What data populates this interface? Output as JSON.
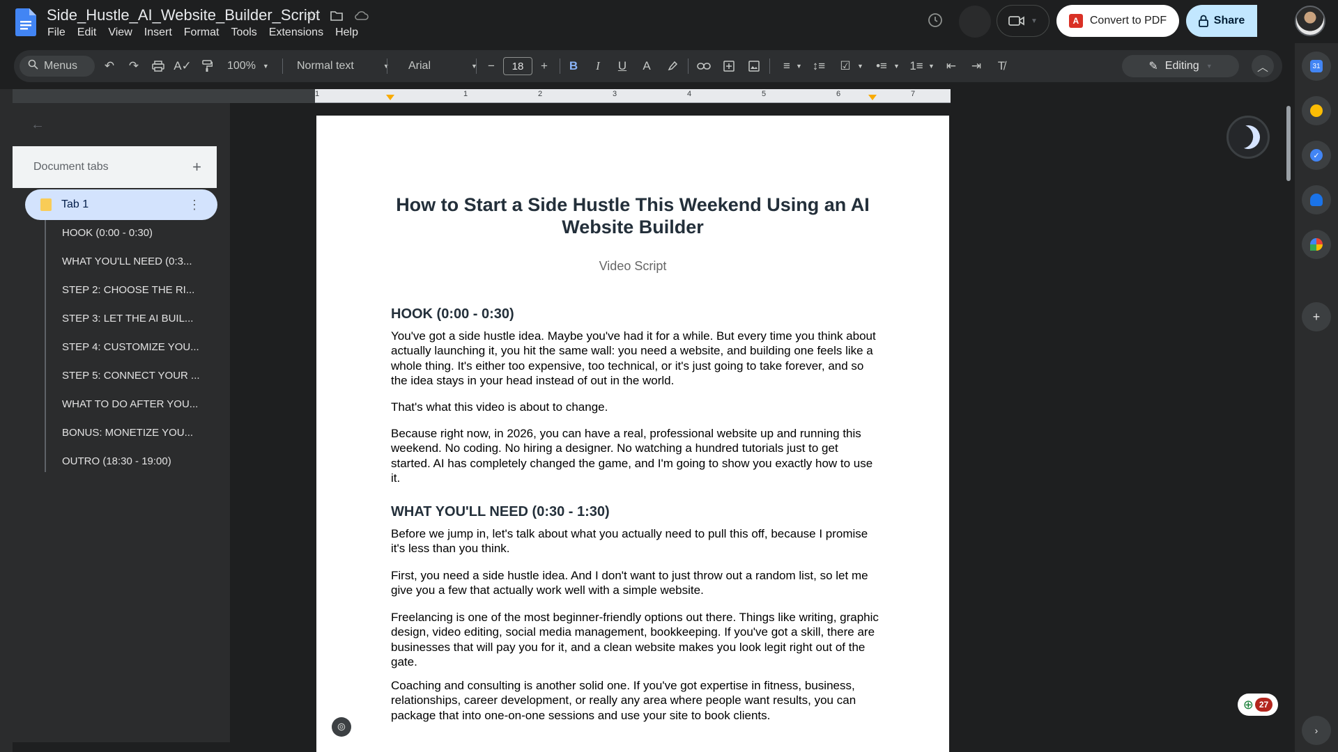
{
  "window": {
    "doc_title": "Side_Hustle_AI_Website_Builder_Script",
    "menu": [
      "File",
      "Edit",
      "View",
      "Insert",
      "Format",
      "Tools",
      "Extensions",
      "Help"
    ]
  },
  "header_actions": {
    "convert_pdf_label": "Convert to PDF",
    "share_label": "Share"
  },
  "toolbar": {
    "menus_label": "Menus",
    "zoom": "100%",
    "style": "Normal text",
    "font": "Arial",
    "font_size": "18",
    "bold_label": "B",
    "italic_label": "I",
    "underline_label": "U",
    "text_color_label": "A",
    "editing_label": "Editing"
  },
  "ruler": {
    "numbers": [
      "1",
      "1",
      "2",
      "3",
      "4",
      "5",
      "6",
      "7"
    ]
  },
  "sidebar": {
    "header": "Document tabs",
    "tab_name": "Tab 1",
    "outline": [
      "HOOK (0:00 - 0:30)",
      "WHAT YOU'LL NEED (0:3...",
      "STEP 2: CHOOSE THE RI...",
      "STEP 3: LET THE AI BUIL...",
      "STEP 4: CUSTOMIZE YOU...",
      "STEP 5: CONNECT YOUR ...",
      "WHAT TO DO AFTER YOU...",
      "BONUS: MONETIZE YOU...",
      "OUTRO (18:30 - 19:00)"
    ]
  },
  "document": {
    "title": "How to Start a Side Hustle This Weekend Using an AI Website Builder",
    "subtitle": "Video Script",
    "sections": [
      {
        "heading": "HOOK (0:00 - 0:30)",
        "paragraphs": [
          "You've got a side hustle idea. Maybe you've had it for a while. But every time you think about actually launching it, you hit the same wall: you need a website, and building one feels like a whole thing. It's either too expensive, too technical, or it's just going to take forever, and so the idea stays in your head instead of out in the world.",
          "That's what this video is about to change.",
          "Because right now, in 2026, you can have a real, professional website up and running this weekend. No coding. No hiring a designer. No watching a hundred tutorials just to get started. AI has completely changed the game, and I'm going to show you exactly how to use it."
        ]
      },
      {
        "heading": "WHAT YOU'LL NEED (0:30 - 1:30)",
        "paragraphs": [
          "Before we jump in, let's talk about what you actually need to pull this off, because I promise it's less than you think.",
          "First, you need a side hustle idea. And I don't want to just throw out a random list, so let me give you a few that actually work well with a simple website.",
          "Freelancing is one of the most beginner-friendly options out there. Things like writing, graphic design, video editing, social media management, bookkeeping. If you've got a skill, there are businesses that will pay you for it, and a clean website makes you look legit right out of the gate.",
          "Coaching and consulting is another solid one. If you've got expertise in fitness, business, relationships, career development, or really any area where people want results, you can package that into one-on-one sessions and use your site to book clients."
        ]
      }
    ]
  },
  "floating": {
    "comment_count": "27"
  },
  "colors": {
    "accent_blue": "#c2e7ff",
    "tab_highlight": "#d3e3fd",
    "pdf_red": "#d93025",
    "badge_red": "#b3261e"
  }
}
